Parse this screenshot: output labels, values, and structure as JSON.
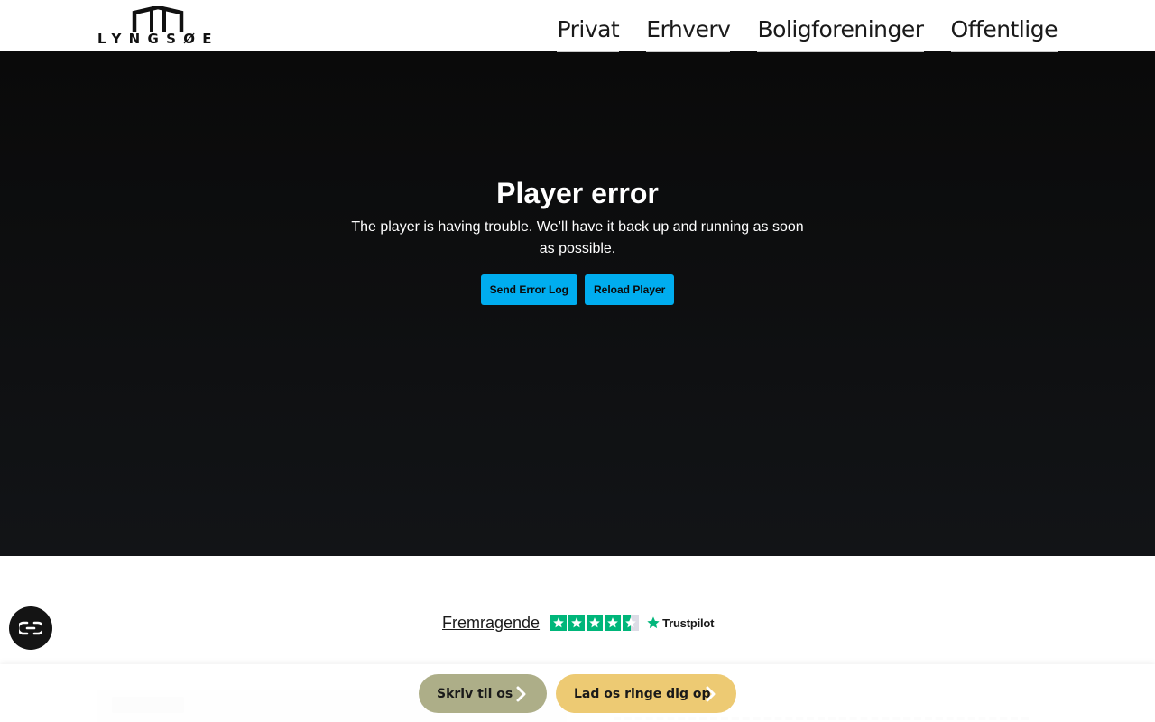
{
  "header": {
    "logo_text": "LYNGSØE",
    "nav": [
      {
        "label": "Privat"
      },
      {
        "label": "Erhverv"
      },
      {
        "label": "Boligforeninger"
      },
      {
        "label": "Offentlige"
      }
    ]
  },
  "player": {
    "title": "Player error",
    "description": "The player is having trouble. We’ll have it back up and running as soon as possible.",
    "send_log_label": "Send Error Log",
    "reload_label": "Reload Player",
    "button_color": "#00adef"
  },
  "trustpilot": {
    "rating_label": "Fremragende",
    "brand": "Trustpilot",
    "stars": 4.5,
    "star_color": "#00b67a"
  },
  "cta": {
    "write_label": "Skriv til os",
    "call_label": "Lad os ringe dig op",
    "write_color": "#adae88",
    "call_color": "#edca73"
  },
  "accessibility": {
    "icon": "accessibility-icon"
  }
}
